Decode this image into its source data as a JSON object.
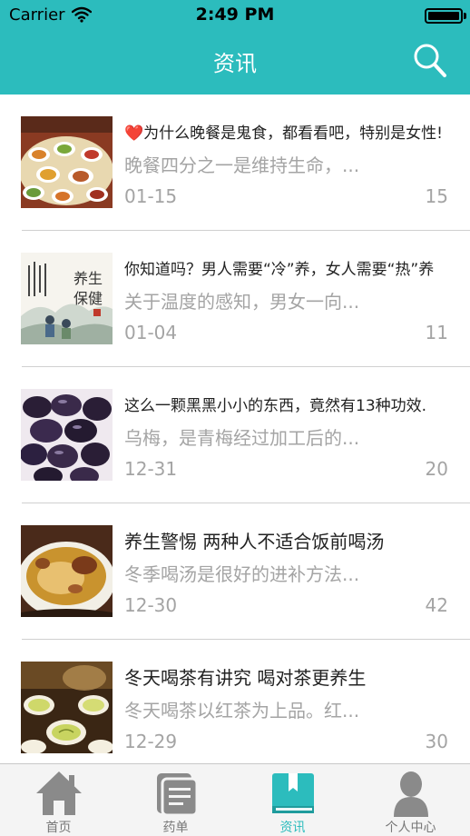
{
  "status_bar": {
    "carrier": "Carrier",
    "time": "2:49 PM"
  },
  "nav": {
    "title": "资讯",
    "search_icon": "search-icon"
  },
  "feed": {
    "items": [
      {
        "title": "❤️为什么晚餐是鬼食，都看看吧，特别是女性!",
        "summary": "晚餐四分之一是维持生命，...",
        "date": "01-15",
        "count": "15",
        "thumb": "dinner-table-photo"
      },
      {
        "title": "你知道吗？男人需要“冷”养，女人需要“热”养",
        "summary": "关于温度的感知，男女一向...",
        "date": "01-04",
        "count": "11",
        "thumb": "wellness-painting"
      },
      {
        "title": "这么一颗黑黑小小的东西，竟然有13种功效.",
        "summary": "乌梅，是青梅经过加工后的...",
        "date": "12-31",
        "count": "20",
        "thumb": "dried-plums-photo"
      },
      {
        "title": "养生警惕 两种人不适合饭前喝汤",
        "summary": "冬季喝汤是很好的进补方法...",
        "date": "12-30",
        "count": "42",
        "thumb": "chicken-soup-photo"
      },
      {
        "title": "冬天喝茶有讲究 喝对茶更养生",
        "summary": "冬天喝茶以红茶为上品。红...",
        "date": "12-29",
        "count": "30",
        "thumb": "tea-cups-photo"
      }
    ]
  },
  "tabbar": {
    "tabs": [
      {
        "label": "首页",
        "icon": "home-icon",
        "active": false
      },
      {
        "label": "药单",
        "icon": "document-icon",
        "active": false
      },
      {
        "label": "资讯",
        "icon": "book-icon",
        "active": true
      },
      {
        "label": "个人中心",
        "icon": "person-icon",
        "active": false
      }
    ]
  },
  "colors": {
    "accent": "#2cbcbd",
    "muted_text": "#a4a4a4",
    "tab_icon": "#8a8a8a"
  }
}
